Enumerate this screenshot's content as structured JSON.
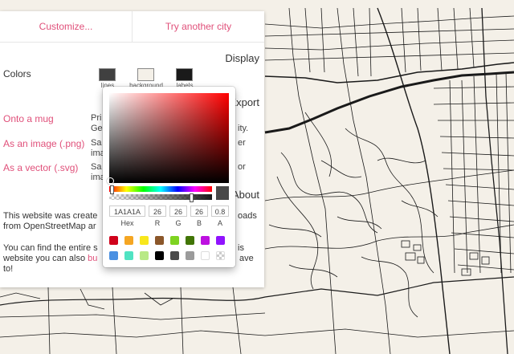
{
  "tabs": [
    {
      "label": "Customize..."
    },
    {
      "label": "Try another city"
    }
  ],
  "display": {
    "title": "Display",
    "colors_label": "Colors",
    "swatches": [
      {
        "label": "lines",
        "color": "#404040"
      },
      {
        "label": "background",
        "color": "#f4f0e8"
      },
      {
        "label": "labels",
        "color": "#1a1a1a"
      }
    ]
  },
  "export": {
    "title": "Export",
    "items": [
      {
        "link": "Onto a mug",
        "desc1": "Pri",
        "desc2": "Ge",
        "end1": "ity.",
        "end2": ""
      },
      {
        "link": "As an image (.png)",
        "desc1": "Sa",
        "desc2": "ima",
        "end1": "er",
        "end2": ""
      },
      {
        "link": "As a vector (.svg)",
        "desc1": "Sa",
        "desc2": "ima",
        "end1": "or",
        "end2": ""
      }
    ]
  },
  "about": {
    "title": "About",
    "p1_line1_a": "This website was create",
    "p1_line1_b": "oads",
    "p1_line2": "from OpenStreetMap ar",
    "p2_line1_a": "You can find the entire s",
    "p2_line1_b": "is",
    "p2_line2_a": "website you can also ",
    "p2_line2_link": "bu",
    "p2_line2_b": "ave",
    "p2_line3": "to!"
  },
  "picker": {
    "current_color": "#1a1a1a",
    "fields": {
      "hex": "1A1A1A",
      "r": "26",
      "g": "26",
      "b": "26",
      "a": "0.8"
    },
    "labels": {
      "hex": "Hex",
      "r": "R",
      "g": "G",
      "b": "B",
      "a": "A"
    },
    "presets": [
      "#d0021b",
      "#f5a623",
      "#f8e71c",
      "#8b572a",
      "#7ed321",
      "#417505",
      "#bd10e0",
      "#9013fe",
      "#4a90e2",
      "#50e3c2",
      "#b8e986",
      "#000000",
      "#4a4a4a",
      "#9b9b9b",
      "#ffffff",
      "transparent"
    ]
  }
}
